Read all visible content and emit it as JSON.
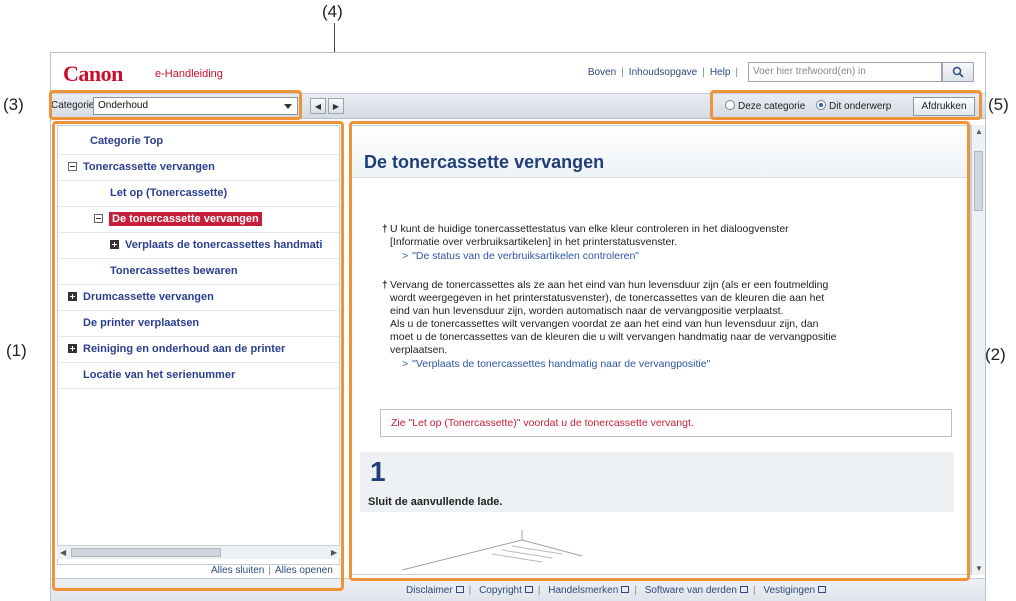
{
  "callouts": {
    "c1": "(1)",
    "c2": "(2)",
    "c3": "(3)",
    "c4": "(4)",
    "c5": "(5)"
  },
  "header": {
    "logo": "Canon",
    "subtitle": "e-Handleiding",
    "links": [
      "Boven",
      "Inhoudsopgave",
      "Help"
    ],
    "search_placeholder": "Voer hier trefwoord(en) in"
  },
  "toolbar": {
    "category_label": "Categorie",
    "category_value": "Onderhoud",
    "radio_category": "Deze categorie",
    "radio_topic": "Dit onderwerp",
    "print_label": "Afdrukken"
  },
  "tree": {
    "items": [
      {
        "label": "Categorie Top"
      },
      {
        "label": "Tonercassette vervangen"
      },
      {
        "label": "Let op (Tonercassette)"
      },
      {
        "label": "De tonercassette vervangen"
      },
      {
        "label": "Verplaats de tonercassettes handmati"
      },
      {
        "label": "Tonercassettes bewaren"
      },
      {
        "label": "Drumcassette vervangen"
      },
      {
        "label": "De printer verplaatsen"
      },
      {
        "label": "Reiniging en onderhoud aan de printer"
      },
      {
        "label": "Locatie van het serienummer"
      }
    ],
    "collapse_all": "Alles sluiten",
    "expand_all": "Alles openen"
  },
  "content": {
    "title": "De tonercassette vervangen",
    "bullet1_line1": "U kunt de huidige tonercassettestatus van elke kleur controleren in het dialoogvenster",
    "bullet1_line2": "[Informatie over verbruiksartikelen] in het printerstatusvenster.",
    "bullet1_link": "\"De status van de verbruiksartikelen controleren\"",
    "bullet2_line1": "Vervang de tonercassettes als ze aan het eind van hun levensduur zijn (als er een foutmelding",
    "bullet2_line2": "wordt weergegeven in het printerstatusvenster), de tonercassettes van de kleuren die aan het",
    "bullet2_line3": "eind van hun levensduur zijn, worden automatisch naar de vervangpositie verplaatst.",
    "bullet2_line4": "Als u de tonercassettes wilt vervangen voordat ze aan het eind van hun levensduur zijn, dan",
    "bullet2_line5": "moet u de tonercassettes van de kleuren die u wilt vervangen handmatig naar de vervangpositie",
    "bullet2_line6": "verplaatsen.",
    "bullet2_link": "\"Verplaats de tonercassettes handmatig naar de vervangpositie\"",
    "note": "Zie \"Let op (Tonercassette)\" voordat u de tonercassette vervangt.",
    "step_number": "1",
    "step_text": "Sluit de aanvullende lade."
  },
  "footer": {
    "links": [
      "Disclaimer",
      "Copyright",
      "Handelsmerken",
      "Software van derden",
      "Vestigingen"
    ]
  }
}
